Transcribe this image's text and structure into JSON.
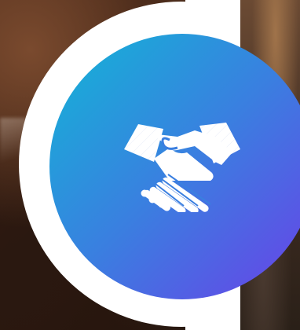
{
  "theme": {
    "circle_gradient_start": "#12b5d6",
    "circle_gradient_end": "#6a40e8",
    "panel_color": "#ffffff",
    "icon_color": "#ffffff"
  },
  "feature": {
    "icon": "handshake-icon"
  }
}
